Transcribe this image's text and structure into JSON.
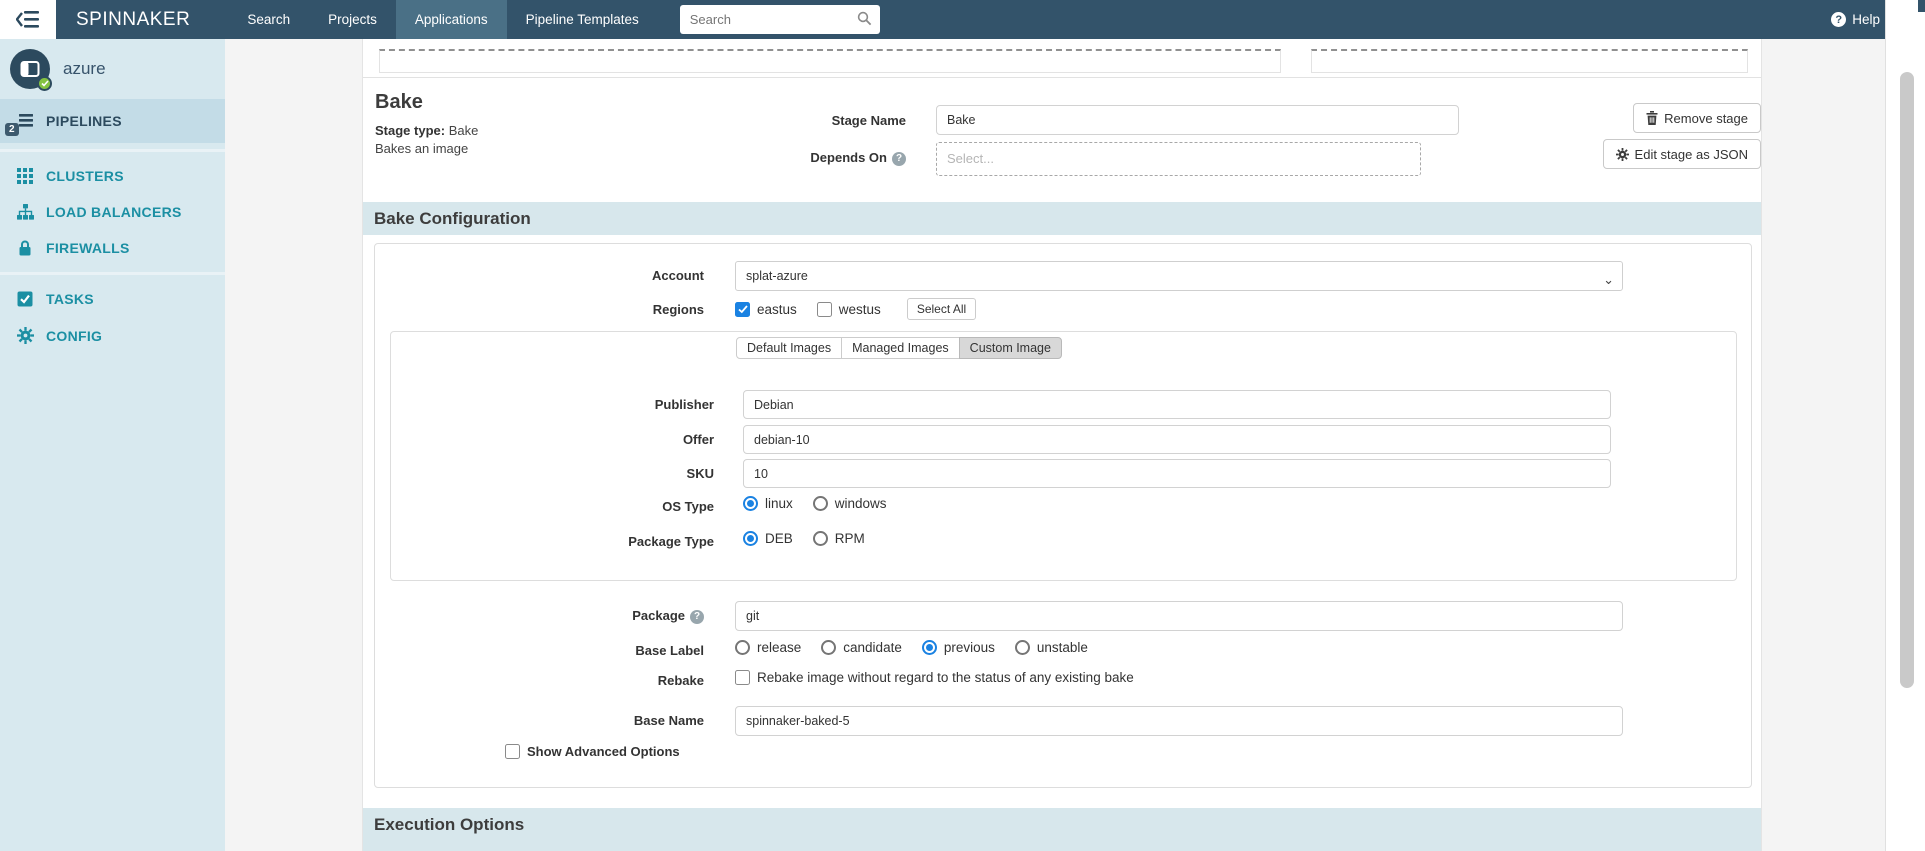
{
  "colors": {
    "nav_bg": "#33536A",
    "nav_active_bg": "#4A7086",
    "sidebar_bg": "#D8E9EF",
    "accent_teal": "#1B8FA3",
    "dark_navy": "#2C4A5E",
    "section_bar_bg": "#D7E7EC",
    "control_blue": "#1A82E2",
    "app_check_green": "#84C341"
  },
  "nav": {
    "brand": "SPINNAKER",
    "items": [
      {
        "label": "Search",
        "active": false
      },
      {
        "label": "Projects",
        "active": false
      },
      {
        "label": "Applications",
        "active": true
      },
      {
        "label": "Pipeline Templates",
        "active": false
      }
    ],
    "search_placeholder": "Search",
    "help_label": "Help"
  },
  "sidebar": {
    "app_name": "azure",
    "pipelines": {
      "label": "PIPELINES",
      "badge": "2",
      "active": true
    },
    "items": [
      {
        "label": "CLUSTERS"
      },
      {
        "label": "LOAD BALANCERS"
      },
      {
        "label": "FIREWALLS"
      },
      {
        "label": "TASKS"
      },
      {
        "label": "CONFIG"
      }
    ]
  },
  "stage": {
    "title": "Bake",
    "type_label": "Stage type:",
    "type_value": "Bake",
    "description": "Bakes an image",
    "stage_name_label": "Stage Name",
    "stage_name_value": "Bake",
    "depends_on_label": "Depends On",
    "depends_on_placeholder": "Select...",
    "remove_stage_label": "Remove stage",
    "edit_json_label": "Edit stage as JSON"
  },
  "bake_config": {
    "header": "Bake Configuration",
    "account_label": "Account",
    "account_value": "splat-azure",
    "regions_label": "Regions",
    "regions": [
      {
        "label": "eastus",
        "checked": true
      },
      {
        "label": "westus",
        "checked": false
      }
    ],
    "select_all_label": "Select All",
    "tabs": [
      {
        "label": "Default Images",
        "active": false
      },
      {
        "label": "Managed Images",
        "active": false
      },
      {
        "label": "Custom Image",
        "active": true
      }
    ],
    "publisher_label": "Publisher",
    "publisher_value": "Debian",
    "offer_label": "Offer",
    "offer_value": "debian-10",
    "sku_label": "SKU",
    "sku_value": "10",
    "os_type_label": "OS Type",
    "os_type_options": [
      {
        "label": "linux",
        "selected": true
      },
      {
        "label": "windows",
        "selected": false
      }
    ],
    "package_type_label": "Package Type",
    "package_type_options": [
      {
        "label": "DEB",
        "selected": true
      },
      {
        "label": "RPM",
        "selected": false
      }
    ],
    "package_label": "Package",
    "package_value": "git",
    "base_label_label": "Base Label",
    "base_label_options": [
      {
        "label": "release",
        "selected": false
      },
      {
        "label": "candidate",
        "selected": false
      },
      {
        "label": "previous",
        "selected": true
      },
      {
        "label": "unstable",
        "selected": false
      }
    ],
    "rebake_label": "Rebake",
    "rebake_text": "Rebake image without regard to the status of any existing bake",
    "base_name_label": "Base Name",
    "base_name_value": "spinnaker-baked-5",
    "show_advanced_label": "Show Advanced Options"
  },
  "execution": {
    "header": "Execution Options"
  }
}
